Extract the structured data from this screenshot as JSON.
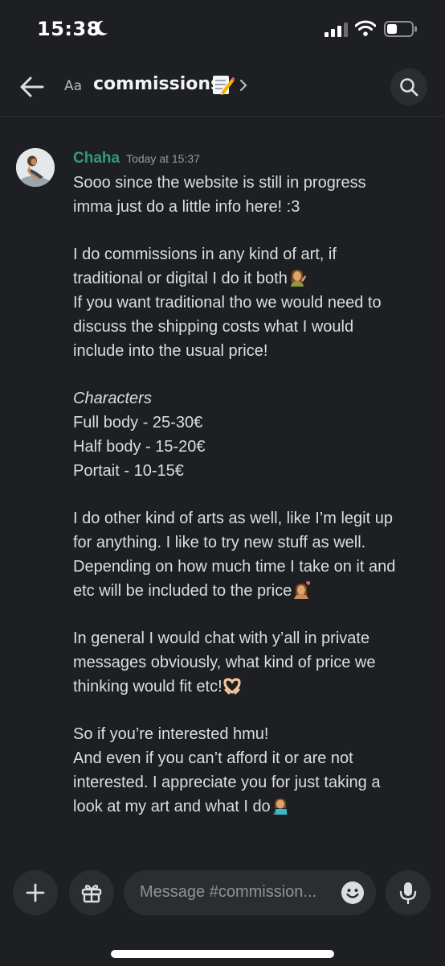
{
  "status_bar": {
    "time": "15:38",
    "icons": [
      "moon-icon",
      "signal-icon",
      "wifi-icon",
      "battery-icon"
    ]
  },
  "header": {
    "aa_label": "Aa",
    "channel_name": "commissions",
    "channel_emoji": "memo-emoji",
    "icons": [
      "back-arrow-icon",
      "chevron-right-icon",
      "search-icon"
    ]
  },
  "message": {
    "username": "Chaha",
    "timestamp": "Today at 15:37",
    "username_color": "#2f9e7a",
    "lines": {
      "l1": "Sooo since the website is still in progress",
      "l2": "imma just do a little info here! :3",
      "l3": "I do commissions in any kind of art, if",
      "l4": "traditional or digital I do it both",
      "l5": "If you want traditional tho we would need to",
      "l6": "discuss the shipping costs what I would",
      "l7": "include into the usual price!",
      "l8": "Characters",
      "l9": "Full body - 25-30€",
      "l10": "Half body - 15-20€",
      "l11": "Portait - 10-15€",
      "l12": "I do other kind of arts as well, like I’m legit up",
      "l13": "for anything. I like to try new stuff as well.",
      "l14": "Depending on how much time I take on it and",
      "l15": "etc will be included to the price",
      "l16": "In general I would chat with y’all in private",
      "l17": "messages obviously, what kind of price we",
      "l18": "thinking would fit etc!",
      "l19": "So if you’re interested hmu!",
      "l20": "And even if you can’t afford it or are not",
      "l21": "interested. I appreciate you for just taking a",
      "l22": "look at my art and what I do"
    }
  },
  "composer": {
    "placeholder": "Message #commission...",
    "icons": [
      "plus-icon",
      "gift-icon",
      "emoji-icon",
      "microphone-icon"
    ]
  }
}
